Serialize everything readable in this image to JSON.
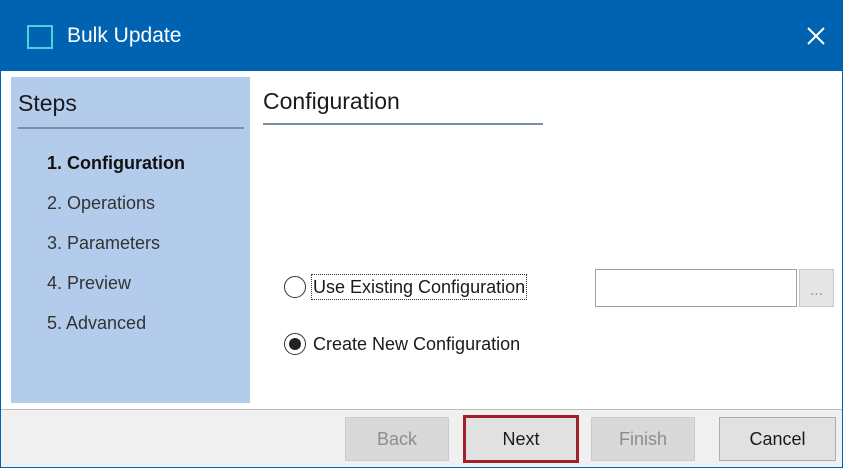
{
  "window": {
    "title": "Bulk Update",
    "accent": "#0063b1"
  },
  "steps": {
    "header": "Steps",
    "items": [
      {
        "label": "1. Configuration",
        "active": true
      },
      {
        "label": "2. Operations",
        "active": false
      },
      {
        "label": "3. Parameters",
        "active": false
      },
      {
        "label": "4. Preview",
        "active": false
      },
      {
        "label": "5. Advanced",
        "active": false
      }
    ]
  },
  "main": {
    "title": "Configuration",
    "options": [
      {
        "label": "Use Existing Configuration",
        "selected": false
      },
      {
        "label": "Create New Configuration",
        "selected": true
      }
    ],
    "config_path": {
      "value": "",
      "placeholder": ""
    },
    "browse_label": "..."
  },
  "footer": {
    "back_label": "Back",
    "next_label": "Next",
    "finish_label": "Finish",
    "cancel_label": "Cancel"
  },
  "icons": {
    "app": "window-icon",
    "close": "close-icon"
  }
}
